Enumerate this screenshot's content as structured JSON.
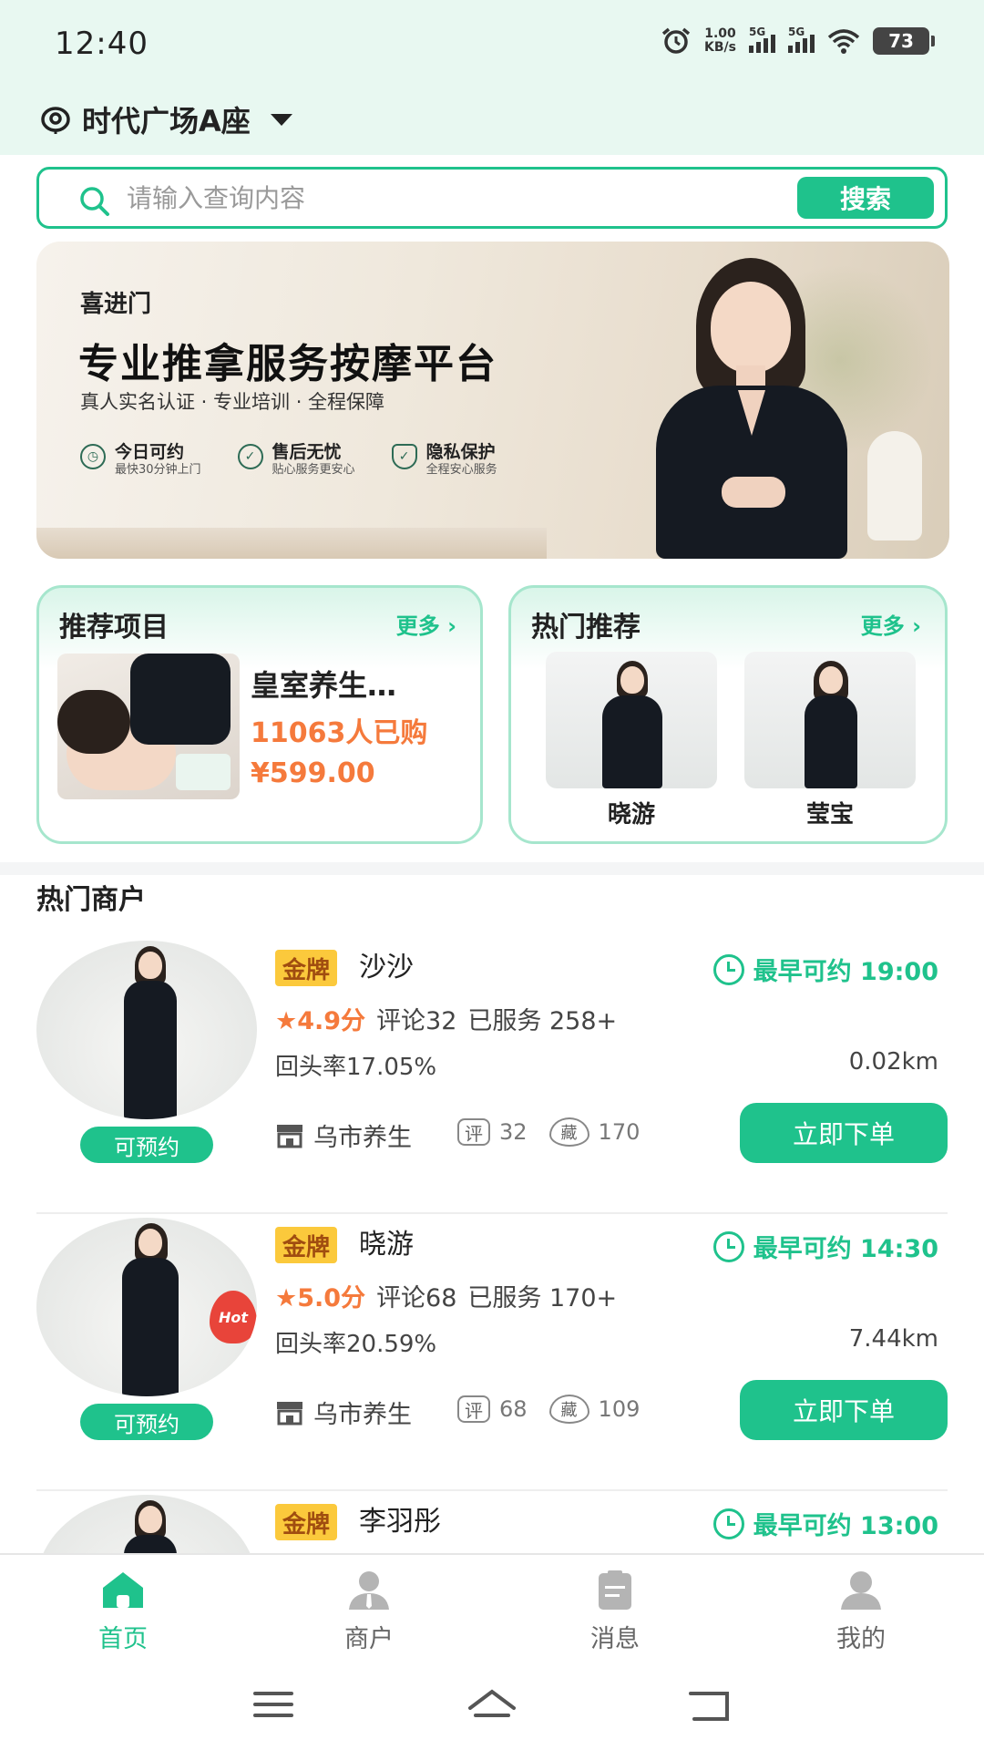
{
  "status_bar": {
    "time": "12:40",
    "net_speed_value": "1.00",
    "net_speed_unit": "KB/s",
    "signal1_label": "5G",
    "signal2_label": "5G",
    "battery": "73"
  },
  "location": {
    "name": "时代广场A座",
    "icon": "location-pin-icon"
  },
  "search": {
    "placeholder": "请输入查询内容",
    "button_label": "搜索"
  },
  "banner": {
    "brand": "喜进门",
    "title": "专业推拿服务按摩平台",
    "subtitle": "真人实名认证 · 专业培训 · 全程保障",
    "features": [
      {
        "title": "今日可约",
        "desc": "最快30分钟上门",
        "icon": "clock-icon"
      },
      {
        "title": "售后无忧",
        "desc": "贴心服务更安心",
        "icon": "check-circle-icon"
      },
      {
        "title": "隐私保护",
        "desc": "全程安心服务",
        "icon": "shield-icon"
      }
    ]
  },
  "recommend": {
    "title": "推荐项目",
    "more": "更多",
    "product": {
      "name": "皇室养生…",
      "sold": "11063人已购",
      "price": "¥599.00"
    }
  },
  "hot": {
    "title": "热门推荐",
    "more": "更多",
    "items": [
      {
        "name": "晓游"
      },
      {
        "name": "莹宝"
      }
    ]
  },
  "merchants": {
    "title": "热门商户",
    "items": [
      {
        "badge": "金牌",
        "name": "沙沙",
        "time": "最早可约 19:00",
        "rating": "4.9分",
        "reviews": "评论32",
        "served": "已服务 258+",
        "repeat": "回头率17.05%",
        "distance": "0.02km",
        "status": "可预约",
        "shop": "乌市养生",
        "review_tag": "评",
        "review_count": "32",
        "fav_tag": "藏",
        "fav_count": "170",
        "order_btn": "立即下单"
      },
      {
        "badge": "金牌",
        "name": "晓游",
        "time": "最早可约 14:30",
        "rating": "5.0分",
        "reviews": "评论68",
        "served": "已服务 170+",
        "repeat": "回头率20.59%",
        "distance": "7.44km",
        "status": "可预约",
        "shop": "乌市养生",
        "review_tag": "评",
        "review_count": "68",
        "fav_tag": "藏",
        "fav_count": "109",
        "order_btn": "立即下单",
        "hot_label": "Hot"
      },
      {
        "badge": "金牌",
        "name": "李羽彤",
        "time": "最早可约 13:00"
      }
    ]
  },
  "tabs": [
    {
      "label": "首页",
      "icon": "home-icon",
      "active": true
    },
    {
      "label": "商户",
      "icon": "merchant-icon",
      "active": false
    },
    {
      "label": "消息",
      "icon": "message-icon",
      "active": false
    },
    {
      "label": "我的",
      "icon": "profile-icon",
      "active": false
    }
  ],
  "colors": {
    "accent": "#1fc28c",
    "price": "#f57a3c",
    "badge": "#fbc93c"
  }
}
